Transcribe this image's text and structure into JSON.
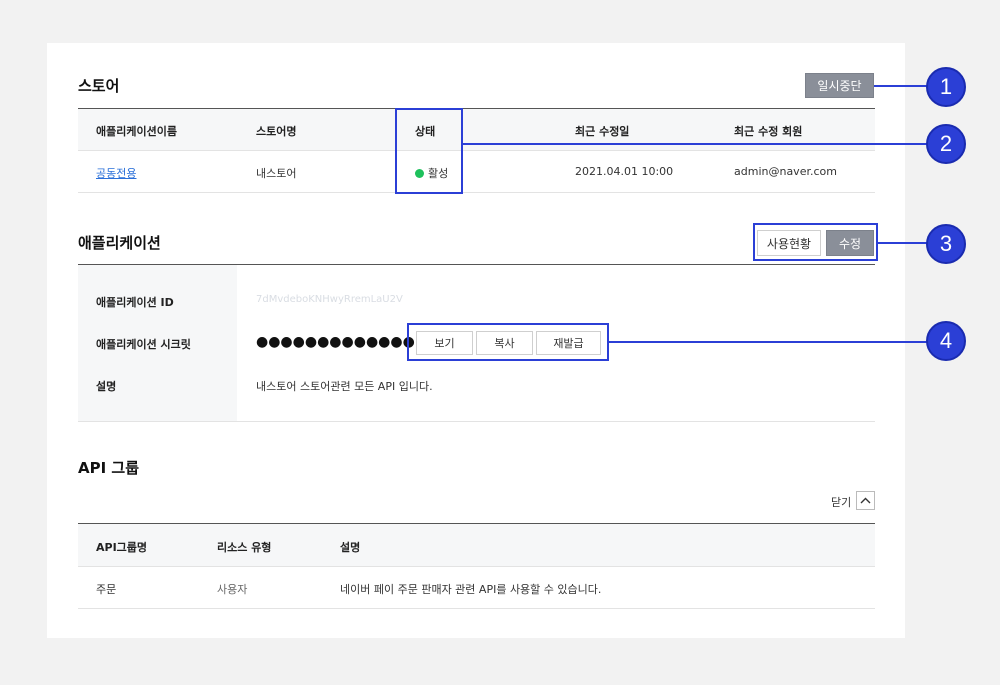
{
  "store": {
    "title": "스토어",
    "pause_button": "일시중단",
    "columns": [
      "애플리케이션이름",
      "스토어명",
      "상태",
      "최근 수정일",
      "최근 수정 회원"
    ],
    "row": {
      "app_name": "공동전용",
      "store_name": "내스토어",
      "status": "활성",
      "modified": "2021.04.01 10:00",
      "modified_by": "admin@naver.com"
    }
  },
  "application": {
    "title": "애플리케이션",
    "usage_button": "사용현황",
    "edit_button": "수정",
    "id_label": "애플리케이션 ID",
    "id_value": "7dMvdeboKNHwyRremLaU2V",
    "secret_label": "애플리케이션 시크릿",
    "secret_value": "●●●●●●●●●●●●●",
    "secret_buttons": [
      "보기",
      "복사",
      "재발급"
    ],
    "desc_label": "설명",
    "desc_value": "내스토어 스토어관련 모든 API 입니다."
  },
  "api_group": {
    "title": "API 그룹",
    "close_label": "닫기",
    "columns": [
      "API그룹명",
      "리소스 유형",
      "설명"
    ],
    "row": {
      "name": "주문",
      "resource_type": "사용자",
      "description": "네이버 페이 주문 판매자 관련 API를 사용할 수 있습니다."
    }
  },
  "callouts": [
    "1",
    "2",
    "3",
    "4"
  ],
  "colors": {
    "accent": "#2b3fd6",
    "status_active": "#1ec15c",
    "link": "#2a6fd8"
  }
}
